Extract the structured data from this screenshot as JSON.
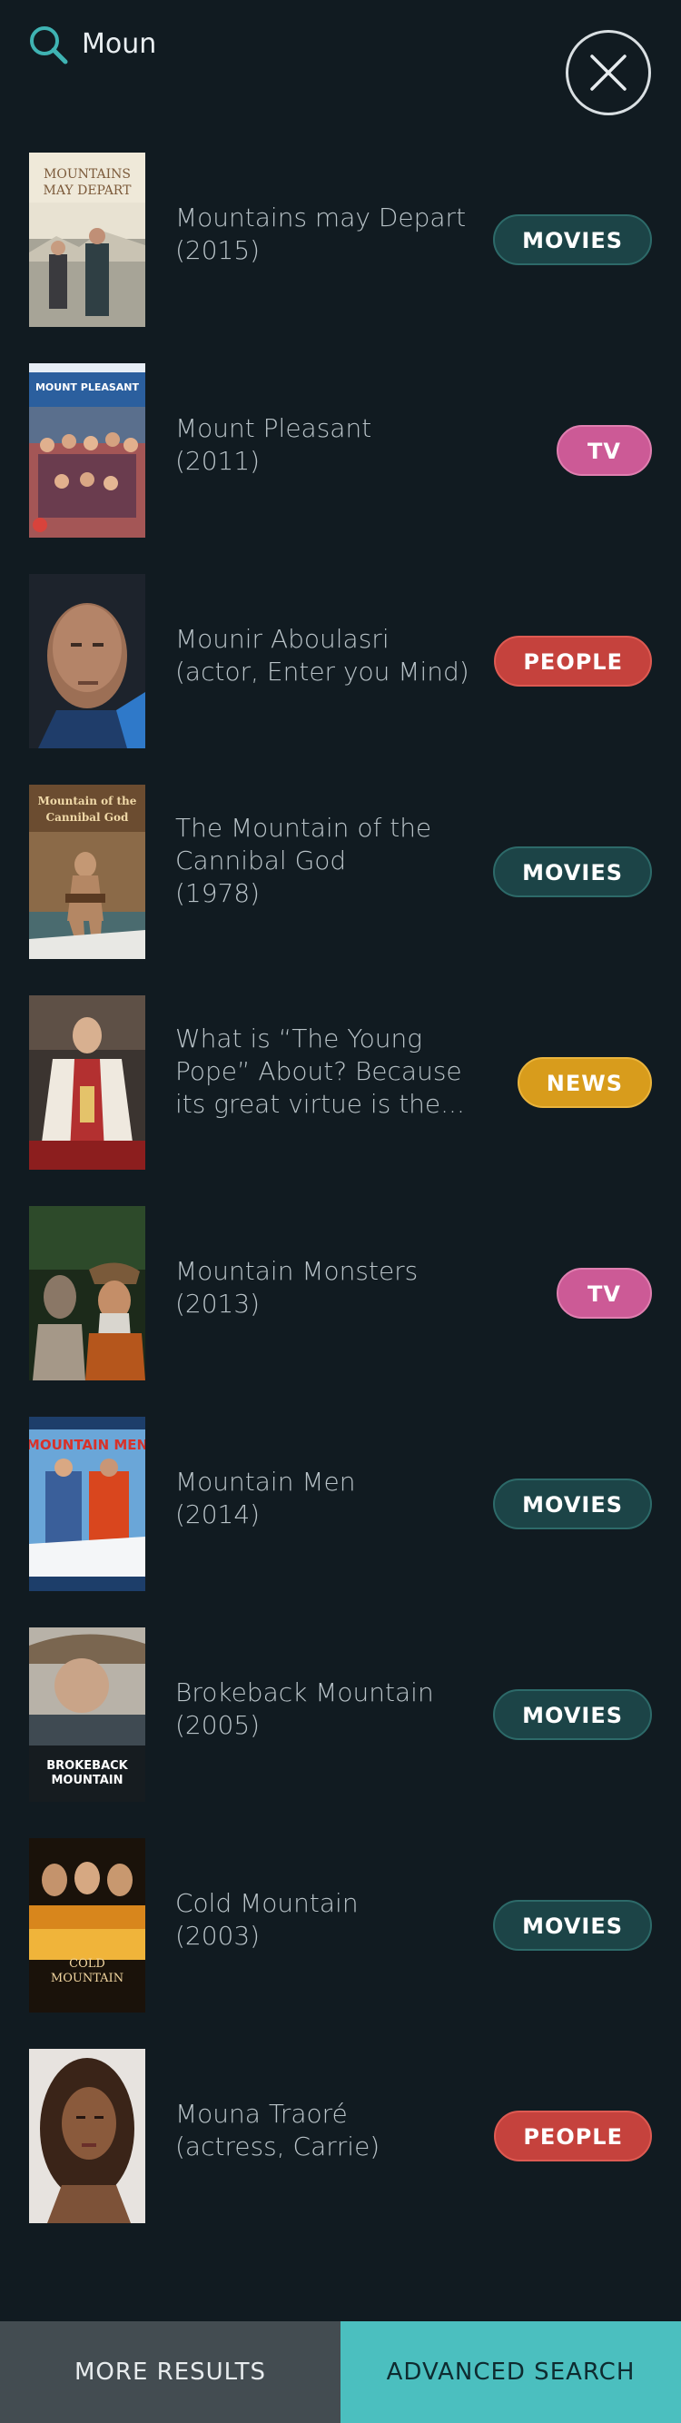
{
  "search": {
    "query": "Moun",
    "icon": "search-icon",
    "close_icon": "close-icon"
  },
  "colors": {
    "background": "#111b21",
    "movies": "#1c4447",
    "tv": "#cc5a96",
    "people": "#c5423d",
    "news": "#d89c1c",
    "advanced": "#4bbfbf"
  },
  "results": [
    {
      "title": "Mountains may Depart\n(2015)",
      "category": "MOVIES",
      "poster_text": "MOUNTAINS MAY DEPART"
    },
    {
      "title": "Mount Pleasant\n(2011)",
      "category": "TV",
      "poster_text": "MOUNT PLEASANT"
    },
    {
      "title": "Mounir Aboulasri\n(actor, Enter you Mind)",
      "category": "PEOPLE"
    },
    {
      "title": "The Mountain of the\nCannibal God\n(1978)",
      "category": "MOVIES",
      "poster_text": "Mountain of the Cannibal God"
    },
    {
      "title": "What is “The Young\nPope” About? Because\nits great virtue is the...",
      "category": "NEWS"
    },
    {
      "title": "Mountain Monsters\n(2013)",
      "category": "TV"
    },
    {
      "title": "Mountain Men\n(2014)",
      "category": "MOVIES",
      "poster_text": "MOUNTAIN MEN"
    },
    {
      "title": "Brokeback Mountain\n(2005)",
      "category": "MOVIES",
      "poster_text": "BROKEBACK MOUNTAIN"
    },
    {
      "title": "Cold Mountain\n(2003)",
      "category": "MOVIES",
      "poster_text": "COLD MOUNTAIN"
    },
    {
      "title": "Mouna Traoré\n(actress, Carrie)",
      "category": "PEOPLE"
    }
  ],
  "bottom": {
    "more_results": "MORE RESULTS",
    "advanced_search": "ADVANCED SEARCH"
  }
}
